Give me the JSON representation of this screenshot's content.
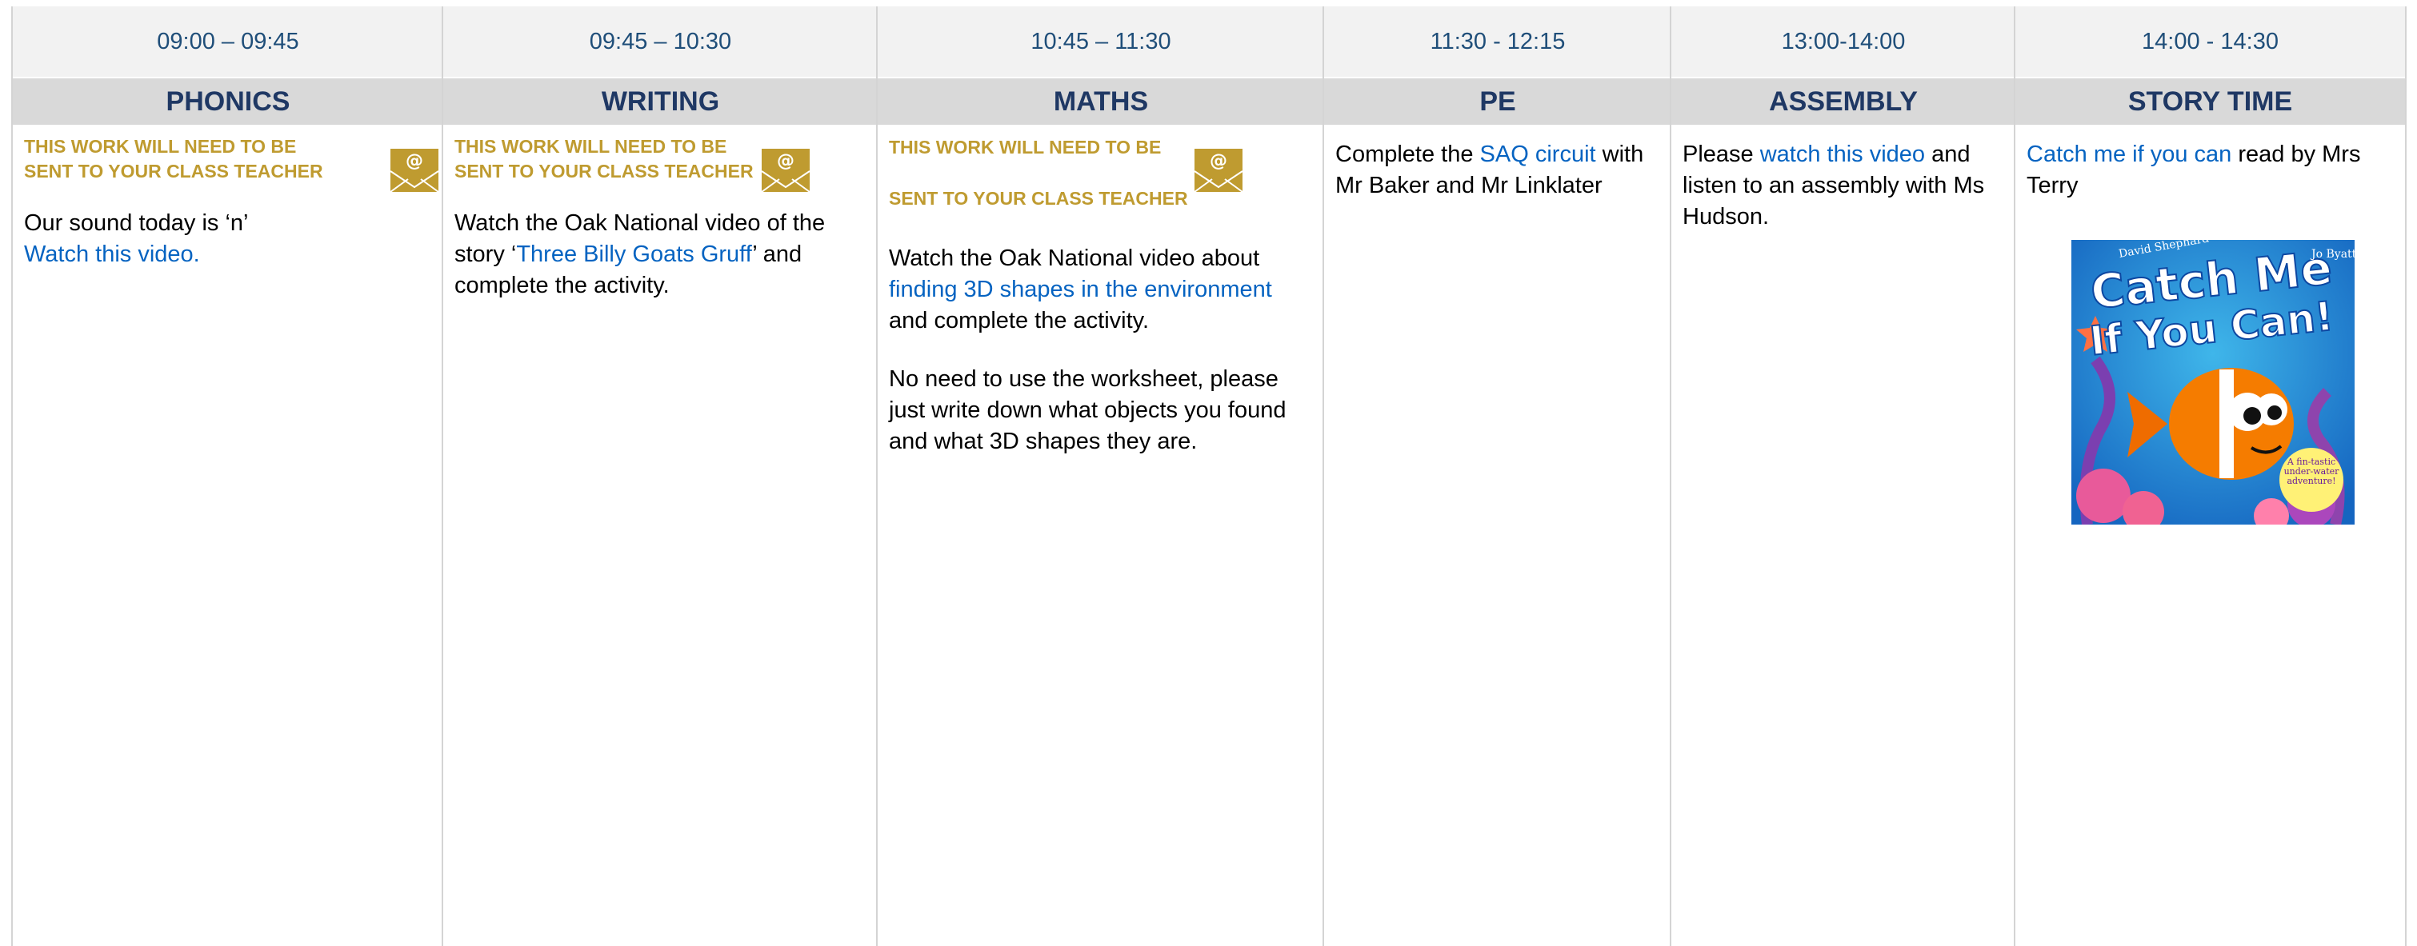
{
  "columns": [
    {
      "time": "09:00 – 09:45",
      "subject": "PHONICS",
      "notice": "THIS WORK WILL NEED TO BE SENT TO YOUR CLASS TEACHER",
      "paragraphs": [
        {
          "text": "Our sound today is ‘n’"
        },
        {
          "link": "Watch this video."
        }
      ]
    },
    {
      "time": "09:45 – 10:30",
      "subject": "WRITING",
      "notice": "THIS WORK WILL NEED TO BE SENT TO YOUR CLASS TEACHER",
      "text_before": "Watch the Oak National video of the story ‘",
      "link": "Three Billy Goats Gruff",
      "text_after": "’ and complete the activity."
    },
    {
      "time": "10:45 – 11:30",
      "subject": "MATHS",
      "notice_line1": "THIS WORK WILL NEED TO BE",
      "notice_line2": "SENT TO YOUR CLASS TEACHER",
      "text_before": "Watch the Oak National video about ",
      "link": "finding 3D shapes in the environment",
      "text_after": " and complete the activity.",
      "paragraph2": "No need to use the worksheet, please just write down what objects you found and what 3D shapes they are."
    },
    {
      "time": "11:30 - 12:15",
      "subject": "PE",
      "text_before": "Complete the ",
      "link": "SAQ circuit",
      "text_after": " with Mr Baker and Mr Linklater"
    },
    {
      "time": "13:00-14:00",
      "subject": "ASSEMBLY",
      "text_before": "Please ",
      "link": "watch this video",
      "text_after": " and listen to an assembly with Ms Hudson."
    },
    {
      "time": "14:00 - 14:30",
      "subject": "STORY TIME",
      "link": "Catch me if you can",
      "text_after": " read by Mrs Terry",
      "book": {
        "title_line1": "Catch Me",
        "title_line2": "If You Can!",
        "author": "David Shephard",
        "illustrator": "Jo Byatt",
        "tagline": "A fin-tastic under-water adventure!"
      }
    }
  ],
  "colors": {
    "header_time_bg": "#f2f2f2",
    "header_subject_bg": "#d9d9d9",
    "subject_text": "#1f3864",
    "time_text": "#1f4e79",
    "notice_gold": "#bf9b30",
    "link_blue": "#0563c1"
  },
  "icons": [
    "email-envelope-icon"
  ]
}
